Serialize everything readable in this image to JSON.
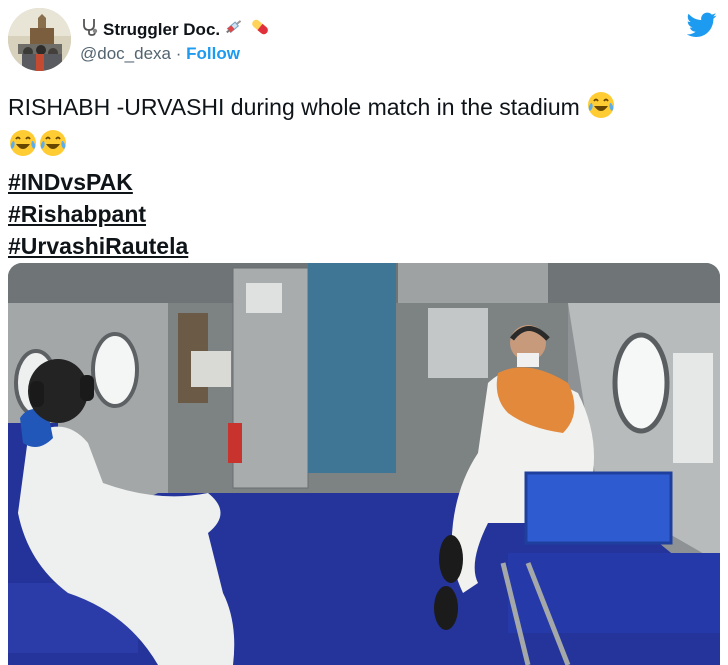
{
  "author": {
    "display_name": "Struggler Doc.",
    "handle": "@doc_dexa",
    "separator": "·",
    "follow_label": "Follow"
  },
  "tweet": {
    "text": "RISHABH -URVASHI during whole match in the stadium",
    "hashtags": [
      "#INDvsPAK",
      "#Rishabpant",
      "#UrvashiRautela"
    ]
  },
  "colors": {
    "accent": "#1d9bf0",
    "text": "#0f1419",
    "secondary": "#536471"
  },
  "icons": {
    "logo": "twitter-bird-icon",
    "name_emoji_left": "stethoscope-icon",
    "name_emoji_mid": "syringe-icon",
    "name_emoji_right": "pill-icon",
    "reaction": "face-with-tears-of-joy-icon"
  }
}
